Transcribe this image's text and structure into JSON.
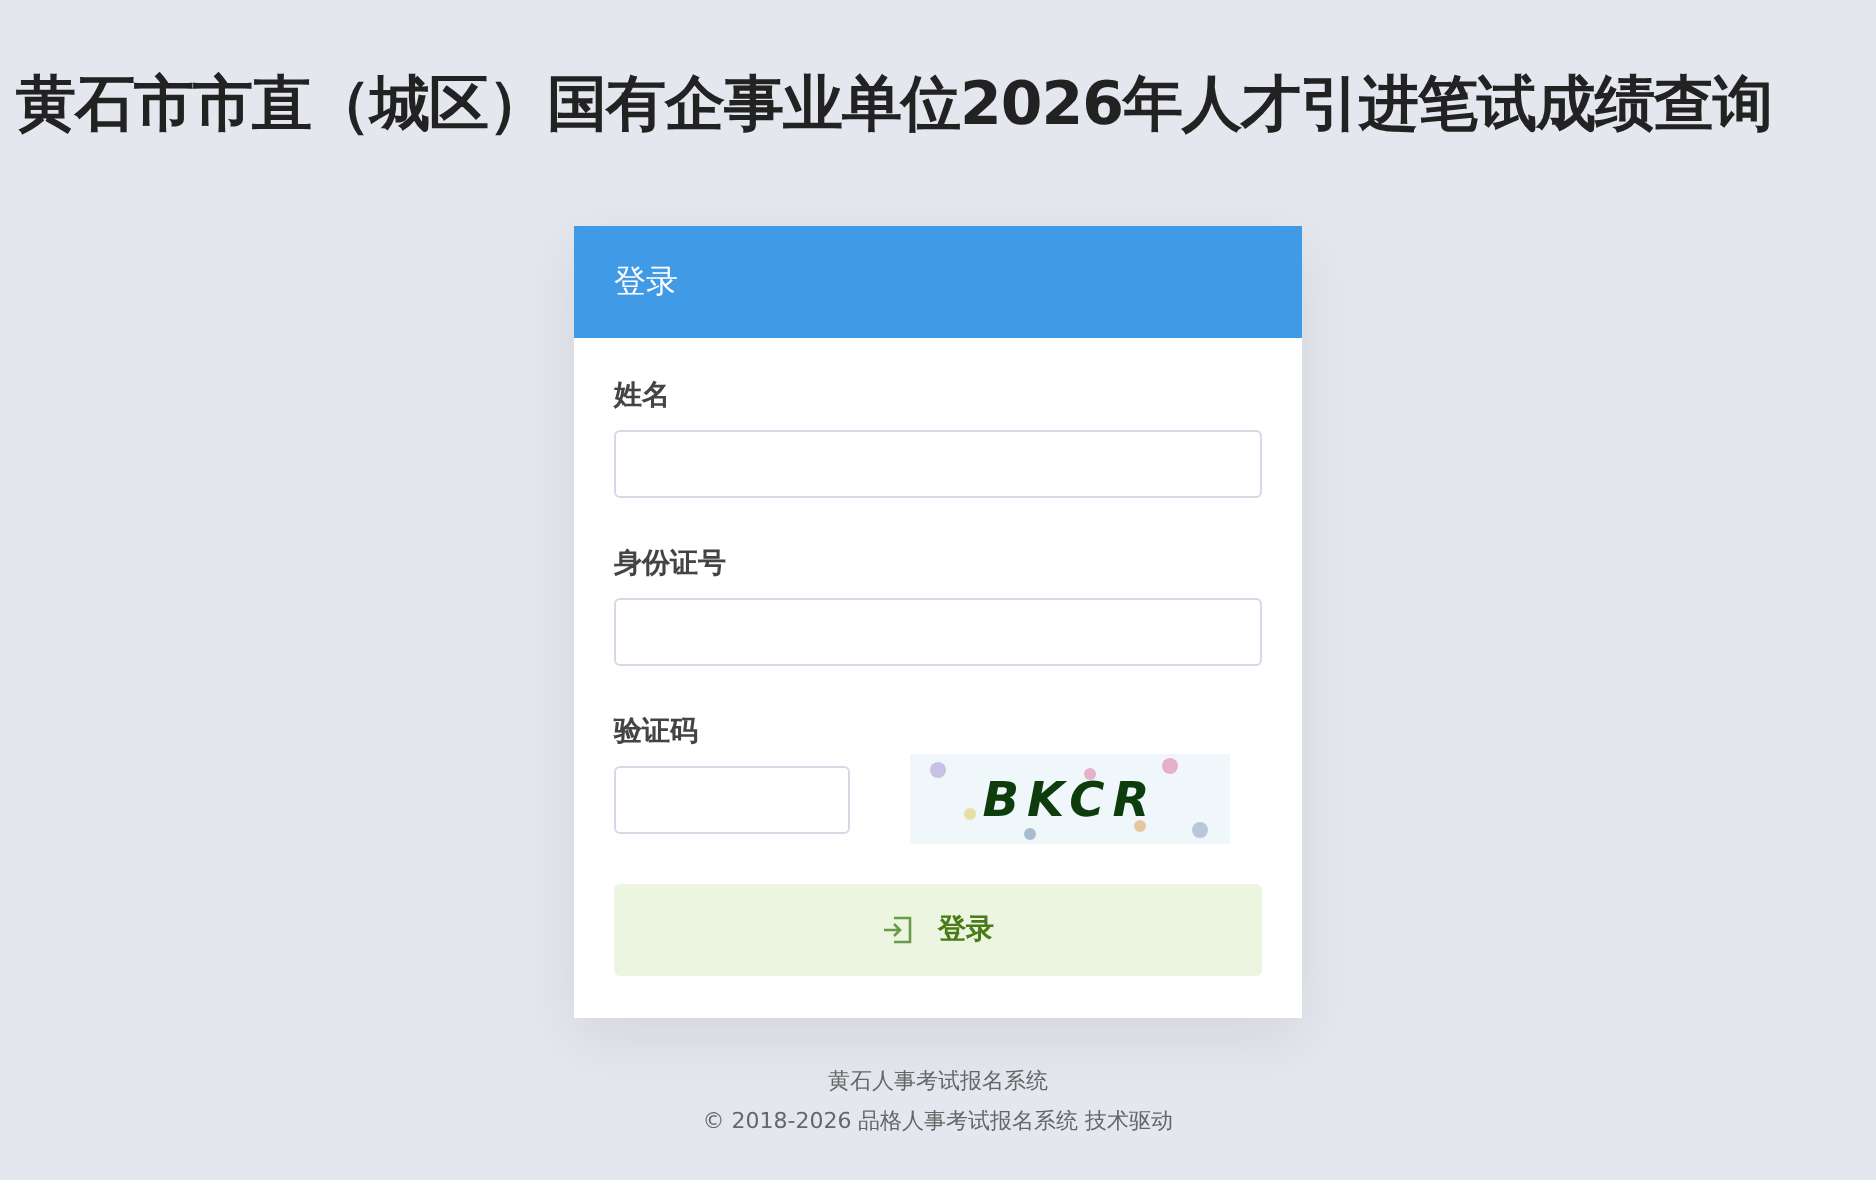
{
  "page_title": "黄石市市直（城区）国有企事业单位2026年人才引进笔试成绩查询",
  "login_card": {
    "title": "登录",
    "fields": [
      {
        "label": "姓名"
      },
      {
        "label": "身份证号"
      }
    ],
    "captcha": {
      "label": "验证码",
      "code": "BKCR"
    },
    "submit": "登录"
  },
  "footer": [
    "黄石人事考试报名系统",
    "© 2018-2026 品格人事考试报名系统 技术驱动"
  ]
}
